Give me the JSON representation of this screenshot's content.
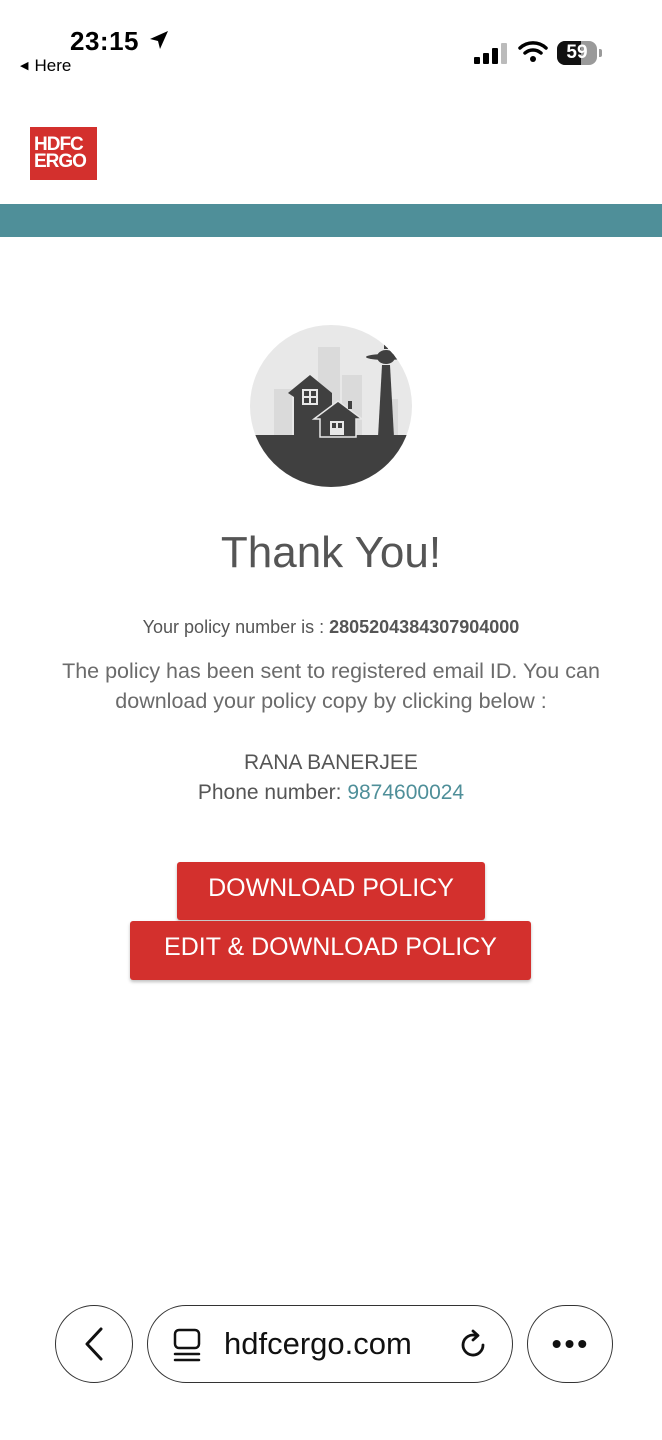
{
  "status_bar": {
    "time": "23:15",
    "back_label": "Here",
    "battery": "59",
    "battery_level": 0.59
  },
  "header": {
    "logo_text_line1": "HDFC",
    "logo_text_line2": "ERGO",
    "brand_color": "#d3302d",
    "bar_color": "#4f8f99"
  },
  "main": {
    "title": "Thank You!",
    "policy_label": "Your policy number is : ",
    "policy_number": "2805204384307904000",
    "sent_message": "The policy has been sent to registered email ID. You can download your policy copy by clicking below :",
    "holder_name": "RANA BANERJEE",
    "phone_label": "Phone number: ",
    "phone_number": "9874600024",
    "download_button": "DOWNLOAD POLICY",
    "edit_download_button": "EDIT & DOWNLOAD POLICY"
  },
  "browser": {
    "url": "hdfcergo.com",
    "more_label": "•••"
  },
  "icons": [
    "location-arrow-icon",
    "signal-icon",
    "wifi-icon",
    "battery-icon",
    "home-illustration-icon",
    "back-chevron-icon",
    "tabs-icon",
    "reload-icon",
    "more-icon"
  ]
}
